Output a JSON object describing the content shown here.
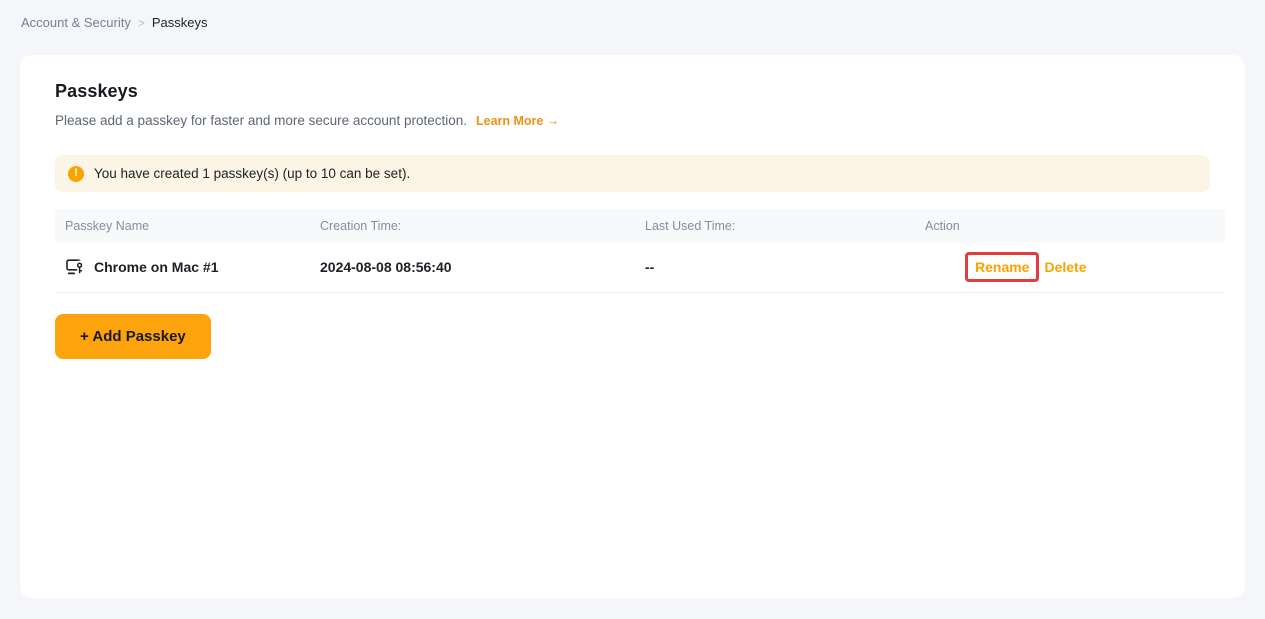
{
  "breadcrumb": {
    "parent": "Account & Security",
    "separator": ">",
    "current": "Passkeys"
  },
  "page": {
    "title": "Passkeys",
    "description": "Please add a passkey for faster and more secure account protection.",
    "learn_more_label": "Learn More →"
  },
  "banner": {
    "icon": "alert-circle-icon",
    "icon_glyph": "!",
    "text": "You have created 1 passkey(s) (up to 10 can be set)."
  },
  "table": {
    "headers": {
      "name": "Passkey Name",
      "creation_time": "Creation Time:",
      "last_used_time": "Last Used Time:",
      "action": "Action"
    },
    "rows": [
      {
        "icon": "passkey-device-icon",
        "name": "Chrome on Mac #1",
        "creation_time": "2024-08-08 08:56:40",
        "last_used_time": "--",
        "rename_label": "Rename",
        "delete_label": "Delete"
      }
    ]
  },
  "buttons": {
    "add_passkey": "+ Add Passkey"
  },
  "colors": {
    "page_background": "#F5F6FA",
    "card_background": "#FFFFFF",
    "accent_orange": "#F8A300",
    "button_orange": "#FCA30D",
    "learn_more_orange": "#ED9117",
    "banner_background": "#FCF5E5",
    "annotation_red": "#E23C3C",
    "text_dark": "#1E2026",
    "text_gray": "#848E9C"
  }
}
